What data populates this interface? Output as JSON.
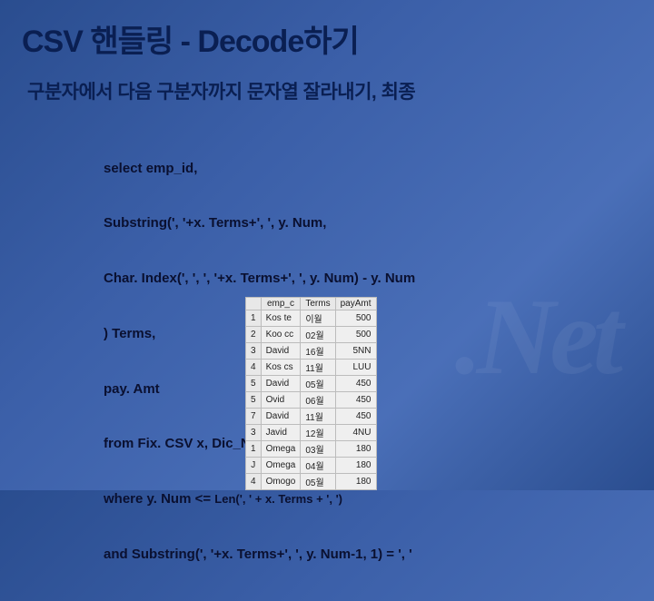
{
  "title": "CSV 핸들링 - Decode하기",
  "subtitle": "구분자에서 다음 구분자까지 문자열 잘라내기, 최종",
  "code": {
    "l1": "select emp_id,",
    "l2": "Substring(', '+x. Terms+', ', y. Num,",
    "l3": "Char. Index(', ', ', '+x. Terms+', ', y. Num) - y. Num",
    "l4": ") Terms,",
    "l5": "pay. Amt",
    "l6": "from Fix. CSV x, Dic_Number y",
    "l7": "where y. Num <= ",
    "l7s": "Len(', ' + x. Terms + ', ')",
    "l8": "and Substring(', '+x. Terms+', ', y. Num-1, 1) = ', '"
  },
  "table": {
    "headers": [
      "",
      "emp_c",
      "Terms",
      "payAmt"
    ],
    "rows": [
      {
        "n": "1",
        "c0": "Kos te",
        "c1": "이월",
        "c2": "500"
      },
      {
        "n": "2",
        "c0": "Koo cc",
        "c1": "02월",
        "c2": "500"
      },
      {
        "n": "3",
        "c0": "David",
        "c1": "16월",
        "c2": "5NN"
      },
      {
        "n": "4",
        "c0": "Kos cs",
        "c1": "11월",
        "c2": "LUU"
      },
      {
        "n": "5",
        "c0": "David",
        "c1": "05월",
        "c2": "450"
      },
      {
        "n": "5",
        "c0": "Ovid",
        "c1": "06월",
        "c2": "450"
      },
      {
        "n": "7",
        "c0": "David",
        "c1": "11월",
        "c2": "450"
      },
      {
        "n": "3",
        "c0": "Javid",
        "c1": "12월",
        "c2": "4NU"
      },
      {
        "n": "1",
        "c0": "Omega",
        "c1": "03월",
        "c2": "180"
      },
      {
        "n": "J",
        "c0": "Omega",
        "c1": "04월",
        "c2": "180"
      },
      {
        "n": "4",
        "c0": "Omogo",
        "c1": "05월",
        "c2": "180"
      }
    ]
  },
  "watermark": ".Net"
}
